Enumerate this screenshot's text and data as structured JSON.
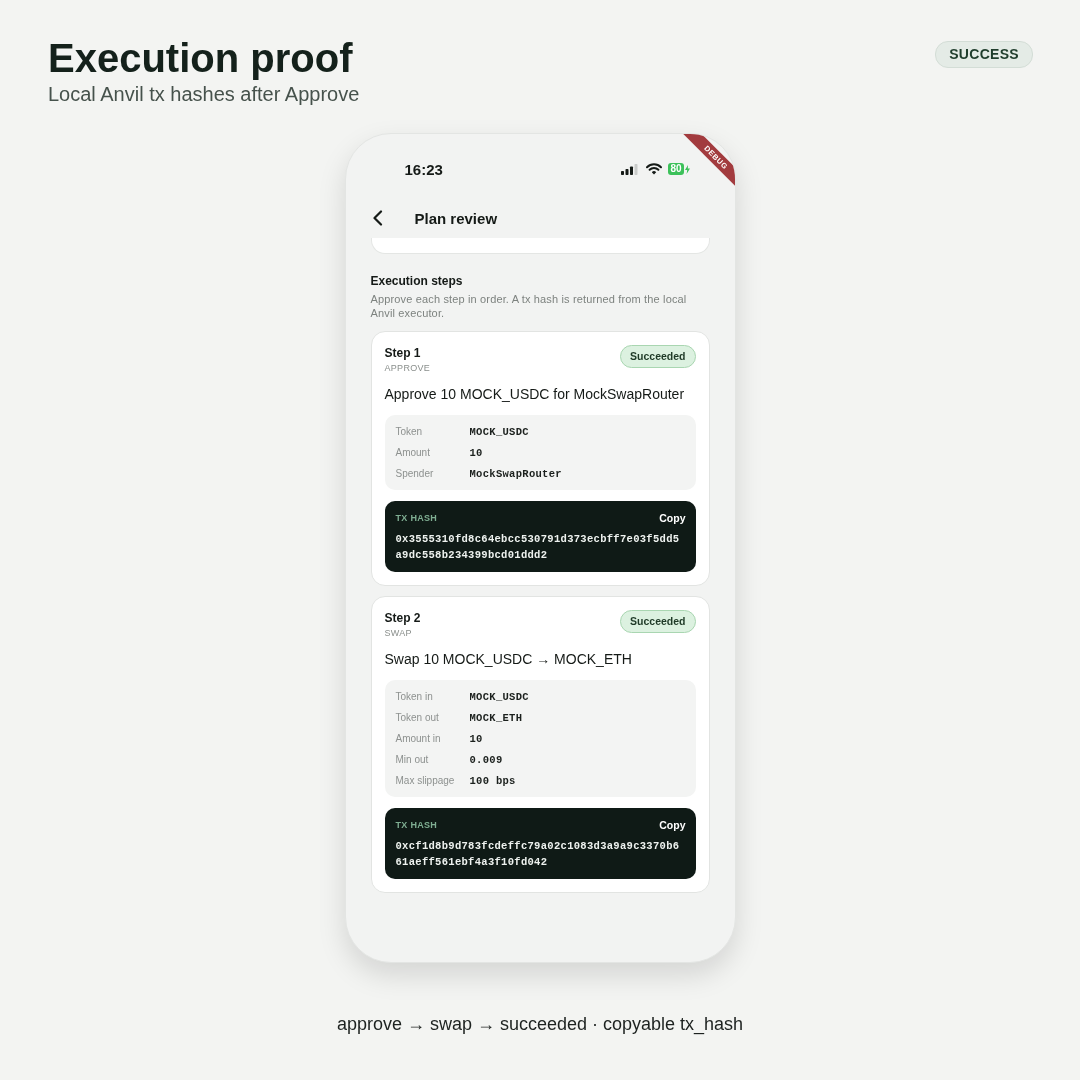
{
  "header": {
    "title": "Execution proof",
    "subtitle": "Local Anvil tx hashes after Approve",
    "badge": "SUCCESS"
  },
  "phone": {
    "status_bar": {
      "time": "16:23",
      "battery": "80"
    },
    "debug_banner": "DEBUG",
    "nav": {
      "title": "Plan review"
    },
    "section": {
      "title": "Execution steps",
      "description": "Approve each step in order. A tx hash is returned from the local Anvil executor."
    },
    "steps": [
      {
        "step": "Step 1",
        "type_label": "APPROVE",
        "status": {
          "label": "Succeeded",
          "kind": "succeeded"
        },
        "title": "Approve 10 MOCK_USDC for MockSwapRouter",
        "details": [
          {
            "label": "Token",
            "value": "MOCK_USDC"
          },
          {
            "label": "Amount",
            "value": "10"
          },
          {
            "label": "Spender",
            "value": "MockSwapRouter"
          }
        ],
        "tx": {
          "label": "TX HASH",
          "action": "Copy",
          "hash": "0x3555310fd8c64ebcc530791d373ecbff7e03f5dd5a9dc558b234399bcd01ddd2"
        }
      },
      {
        "step": "Step 2",
        "type_label": "SWAP",
        "status": {
          "label": "Succeeded",
          "kind": "succeeded"
        },
        "title": "Swap 10 MOCK_USDC → MOCK_ETH",
        "details": [
          {
            "label": "Token in",
            "value": "MOCK_USDC"
          },
          {
            "label": "Token out",
            "value": "MOCK_ETH"
          },
          {
            "label": "Amount in",
            "value": "10"
          },
          {
            "label": "Min out",
            "value": "0.009"
          },
          {
            "label": "Max slippage",
            "value": "100 bps"
          }
        ],
        "tx": {
          "label": "TX HASH",
          "action": "Copy",
          "hash": "0xcf1d8b9d783fcdeffc79a02c1083d3a9a9c3370b661aeff561ebf4a3f10fd042"
        }
      }
    ]
  },
  "caption": "approve → swap → succeeded · copyable tx_hash"
}
